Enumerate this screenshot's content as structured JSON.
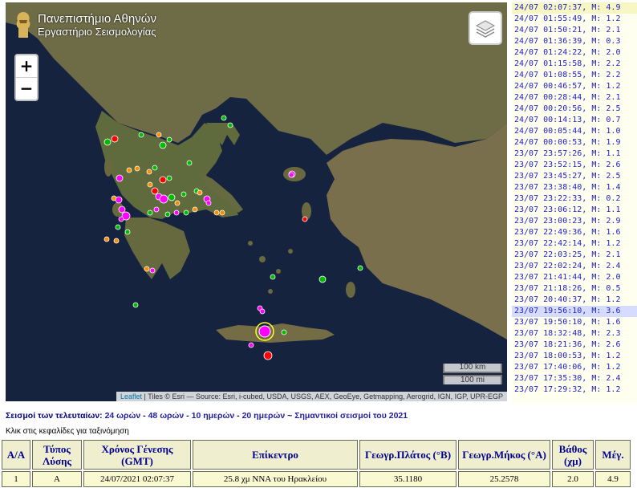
{
  "logo": {
    "line1": "Πανεπιστήμιο Αθηνών",
    "line2": "Εργαστήριο Σεισμολογίας"
  },
  "map": {
    "zoom_in": "+",
    "zoom_out": "−",
    "scale_km": "100 km",
    "scale_mi": "100 mi",
    "attribution_leaflet": "Leaflet",
    "attribution_rest": " | Tiles © Esri — Source: Esri, i-cubed, USDA, USGS, AEX, GeoEye, Getmapping, Aerogrid, IGN, IGP, UPR-EGP",
    "colors": {
      "sea": "#16233e",
      "land": "#6d6a46",
      "recent": "#ff00ff",
      "day": "#ff0000",
      "older": "#ff8c00",
      "oldest": "#00bb00"
    }
  },
  "quakes": [
    {
      "time": "24/07 02:07:37,",
      "mag": "M: 4.9"
    },
    {
      "time": "24/07 01:55:49,",
      "mag": "M: 1.2"
    },
    {
      "time": "24/07 01:50:21,",
      "mag": "M: 2.1"
    },
    {
      "time": "24/07 01:36:39,",
      "mag": "M: 0.3"
    },
    {
      "time": "24/07 01:24:22,",
      "mag": "M: 2.0"
    },
    {
      "time": "24/07 01:15:58,",
      "mag": "M: 2.2"
    },
    {
      "time": "24/07 01:08:55,",
      "mag": "M: 2.2"
    },
    {
      "time": "24/07 00:46:57,",
      "mag": "M: 1.2"
    },
    {
      "time": "24/07 00:28:44,",
      "mag": "M: 2.1"
    },
    {
      "time": "24/07 00:20:56,",
      "mag": "M: 2.5"
    },
    {
      "time": "24/07 00:14:13,",
      "mag": "M: 0.7"
    },
    {
      "time": "24/07 00:05:44,",
      "mag": "M: 1.0"
    },
    {
      "time": "24/07 00:00:53,",
      "mag": "M: 1.9"
    },
    {
      "time": "23/07 23:57:26,",
      "mag": "M: 1.1"
    },
    {
      "time": "23/07 23:52:15,",
      "mag": "M: 2.6"
    },
    {
      "time": "23/07 23:45:27,",
      "mag": "M: 2.5"
    },
    {
      "time": "23/07 23:38:40,",
      "mag": "M: 1.4"
    },
    {
      "time": "23/07 23:22:33,",
      "mag": "M: 0.2"
    },
    {
      "time": "23/07 23:06:12,",
      "mag": "M: 1.1"
    },
    {
      "time": "23/07 23:00:23,",
      "mag": "M: 2.9"
    },
    {
      "time": "23/07 22:49:36,",
      "mag": "M: 1.6"
    },
    {
      "time": "23/07 22:42:14,",
      "mag": "M: 1.2"
    },
    {
      "time": "23/07 22:03:25,",
      "mag": "M: 2.1"
    },
    {
      "time": "23/07 22:02:24,",
      "mag": "M: 2.4"
    },
    {
      "time": "23/07 21:41:44,",
      "mag": "M: 2.0"
    },
    {
      "time": "23/07 21:18:26,",
      "mag": "M: 0.5"
    },
    {
      "time": "23/07 20:40:37,",
      "mag": "M: 1.2"
    },
    {
      "time": "23/07 19:56:10,",
      "mag": "M: 3.6"
    },
    {
      "time": "23/07 19:50:10,",
      "mag": "M: 1.6"
    },
    {
      "time": "23/07 18:32:48,",
      "mag": "M: 2.3"
    },
    {
      "time": "23/07 18:21:36,",
      "mag": "M: 2.6"
    },
    {
      "time": "23/07 18:00:53,",
      "mag": "M: 1.2"
    },
    {
      "time": "23/07 17:40:06,",
      "mag": "M: 1.2"
    },
    {
      "time": "23/07 17:35:30,",
      "mag": "M: 2.4"
    },
    {
      "time": "23/07 17:29:32,",
      "mag": "M: 1.2"
    }
  ],
  "periods": {
    "prefix": "Σεισμοί των τελευταίων: ",
    "h24": "24 ωρών",
    "h48": "48 ωρών",
    "d10": "10 ημερών",
    "d20": "20 ημερών",
    "tilde": "~",
    "significant": "Σημαντικοί σεισμοί του 2021"
  },
  "sort_hint": "Κλικ στις κεφαλίδες για ταξινόμηση",
  "table": {
    "headers": {
      "aa": "Α/Α",
      "type": "Τύπος Λύσης",
      "time": "Χρόνος Γένεσης (GMT)",
      "epicenter": "Επίκεντρο",
      "lat": "Γεωγρ.Πλάτος (°Β)",
      "lon": "Γεωγρ.Μήκος (°Α)",
      "depth": "Βάθος (χμ)",
      "mag": "Μέγ."
    },
    "rows": [
      {
        "aa": "1",
        "type": "A",
        "time": "24/07/2021 02:07:37",
        "epicenter": "25.8 χμ ΝΝΑ του Ηρακλείου",
        "lat": "35.1180",
        "lon": "25.2578",
        "depth": "2.0",
        "mag": "4.9"
      }
    ]
  }
}
